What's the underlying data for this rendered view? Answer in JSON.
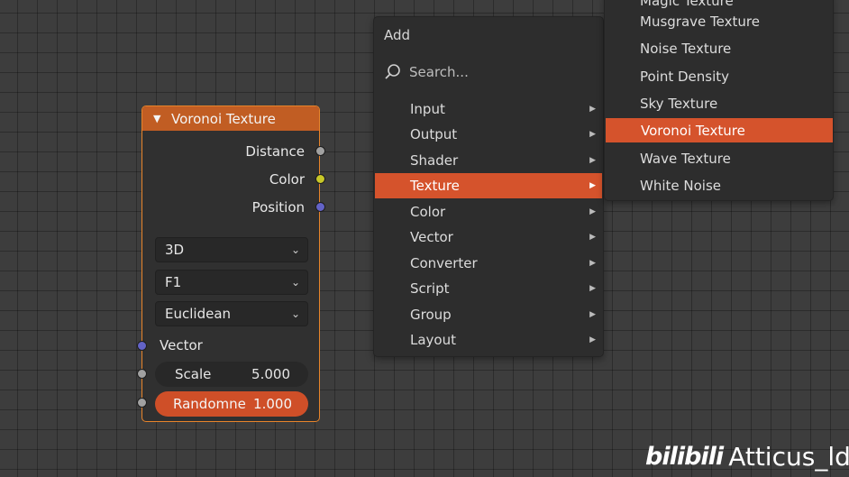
{
  "node": {
    "title": "Voronoi Texture",
    "outputs": [
      "Distance",
      "Color",
      "Position"
    ],
    "dimensions": "3D",
    "feature": "F1",
    "distance_metric": "Euclidean",
    "vector_label": "Vector",
    "scale": {
      "label": "Scale",
      "value": "5.000"
    },
    "randomness": {
      "label": "Randomne",
      "value": "1.000"
    },
    "colors": {
      "header": "#c15d23",
      "border": "#e8842a",
      "socket_grey": "#a1a1a1",
      "socket_yellow": "#c7c729",
      "socket_blue": "#6363c7"
    }
  },
  "add_menu": {
    "title": "Add",
    "search_placeholder": "Search...",
    "items": [
      {
        "label": "Input"
      },
      {
        "label": "Output"
      },
      {
        "label": "Shader"
      },
      {
        "label": "Texture",
        "active": true
      },
      {
        "label": "Color"
      },
      {
        "label": "Vector"
      },
      {
        "label": "Converter"
      },
      {
        "label": "Script"
      },
      {
        "label": "Group"
      },
      {
        "label": "Layout"
      }
    ],
    "highlight_color": "#d5532c"
  },
  "texture_submenu": {
    "items": [
      {
        "label": "Magic Texture"
      },
      {
        "label": "Musgrave Texture"
      },
      {
        "label": "Noise Texture"
      },
      {
        "label": "Point Density"
      },
      {
        "label": "Sky Texture"
      },
      {
        "label": "Voronoi Texture",
        "active": true
      },
      {
        "label": "Wave Texture"
      },
      {
        "label": "White Noise"
      }
    ]
  },
  "watermark": {
    "logo": "bilibili",
    "user": "Atticus_ld"
  }
}
